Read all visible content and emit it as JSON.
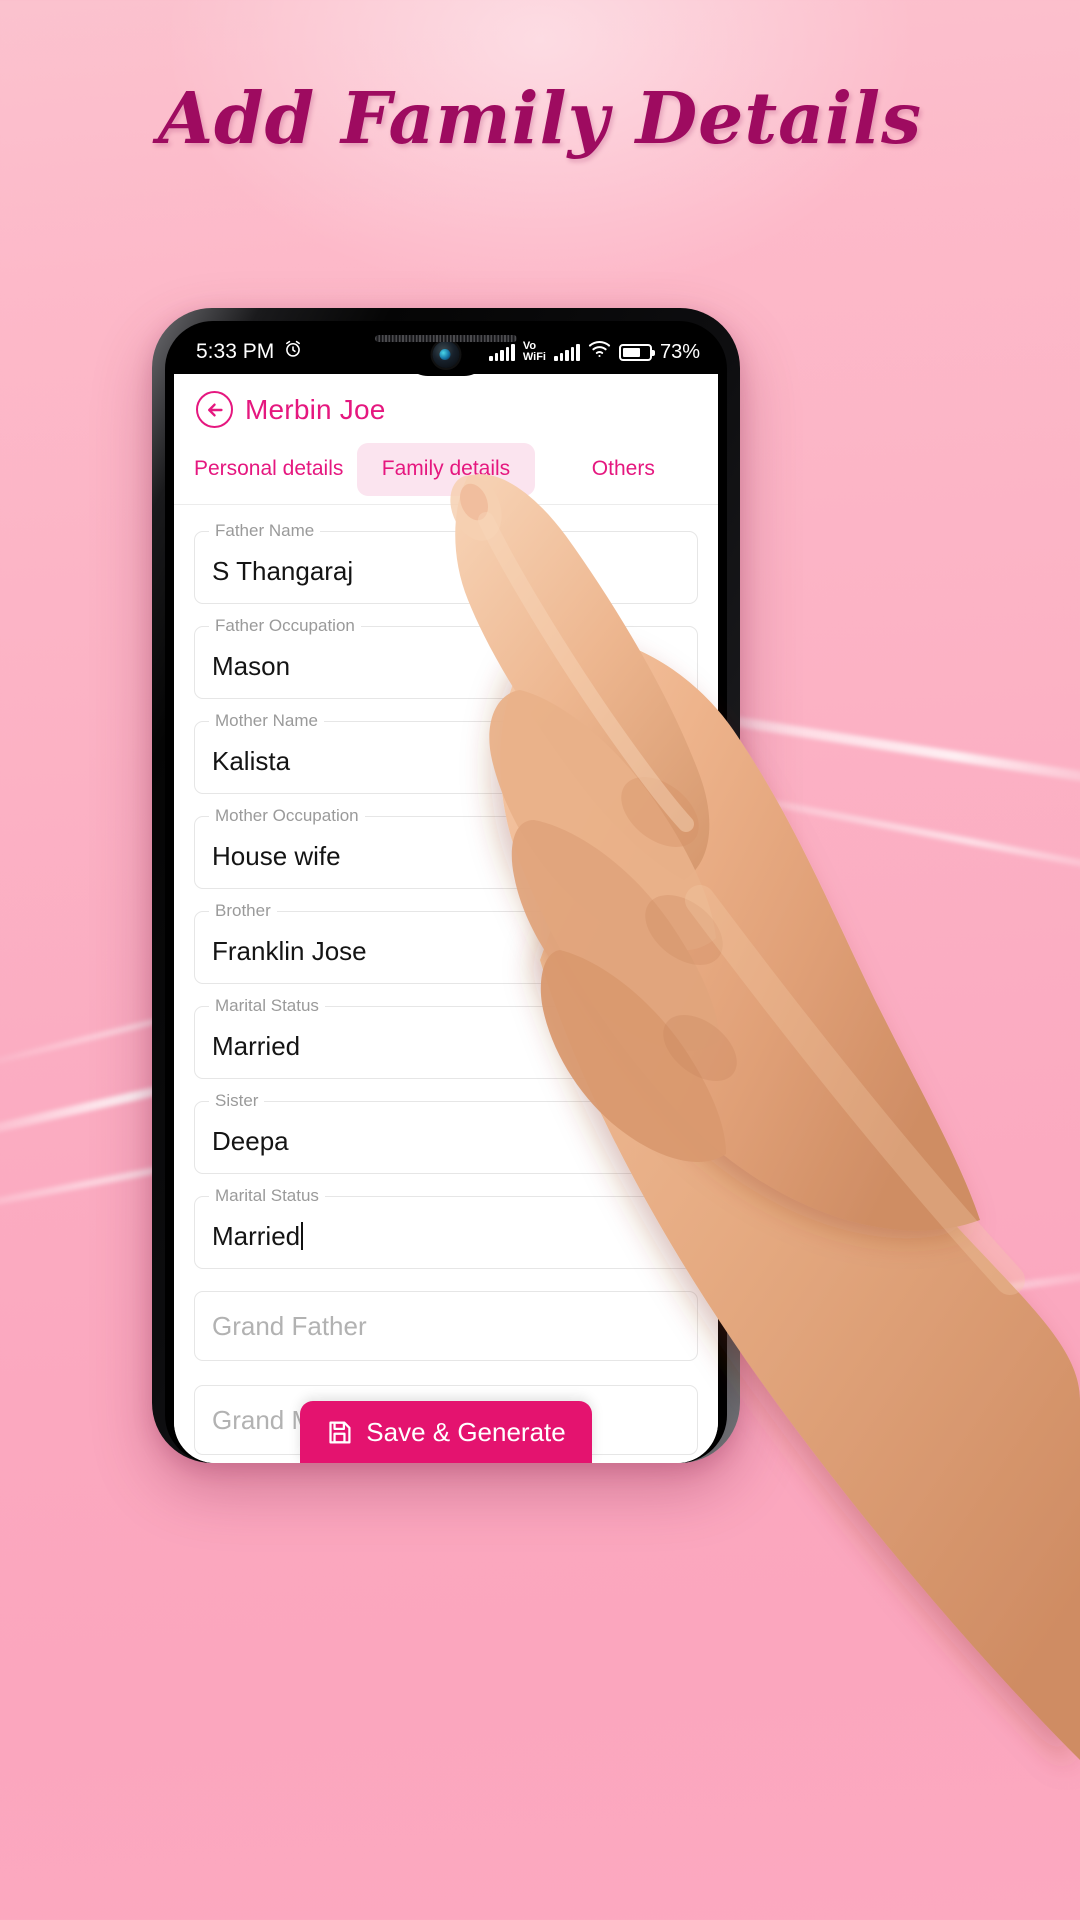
{
  "headline": "Add Family Details",
  "status_bar": {
    "time": "5:33 PM",
    "alarm_icon": "alarm-clock-icon",
    "network_label": "Vo\nWiFi",
    "volte_line1": "Vo",
    "volte_line2": "WiFi",
    "wifi_icon": "wifi-icon",
    "battery_percent": "73%"
  },
  "app_bar": {
    "back_icon": "back-arrow-circle-icon",
    "title": "Merbin Joe"
  },
  "tabs": [
    {
      "label": "Personal details",
      "active": false
    },
    {
      "label": "Family details",
      "active": true
    },
    {
      "label": "Others",
      "active": false
    }
  ],
  "fields": [
    {
      "label": "Father Name",
      "value": "S Thangaraj",
      "placeholder": "",
      "focused": false
    },
    {
      "label": "Father Occupation",
      "value": "Mason",
      "placeholder": "",
      "focused": false
    },
    {
      "label": "Mother Name",
      "value": "Kalista",
      "placeholder": "",
      "focused": false
    },
    {
      "label": "Mother Occupation",
      "value": "House wife",
      "placeholder": "",
      "focused": false
    },
    {
      "label": "Brother",
      "value": "Franklin Jose",
      "placeholder": "",
      "focused": false
    },
    {
      "label": "Marital Status",
      "value": "Married",
      "placeholder": "",
      "focused": false
    },
    {
      "label": "Sister",
      "value": "Deepa",
      "placeholder": "",
      "focused": false
    },
    {
      "label": "Marital Status",
      "value": "Married",
      "placeholder": "",
      "focused": true
    },
    {
      "label": "",
      "value": "",
      "placeholder": "Grand Father",
      "focused": false
    },
    {
      "label": "",
      "value": "",
      "placeholder": "Grand Mother",
      "focused": false
    }
  ],
  "save_button": {
    "label": "Save & Generate",
    "icon": "floppy-disk-save-icon"
  },
  "colors": {
    "brand_pink": "#e5177f",
    "button_pink": "#e4136f",
    "headline_magenta": "#9e0b60",
    "tab_active_bg": "#fbe4ef",
    "background_pink": "#fbb3c6"
  }
}
